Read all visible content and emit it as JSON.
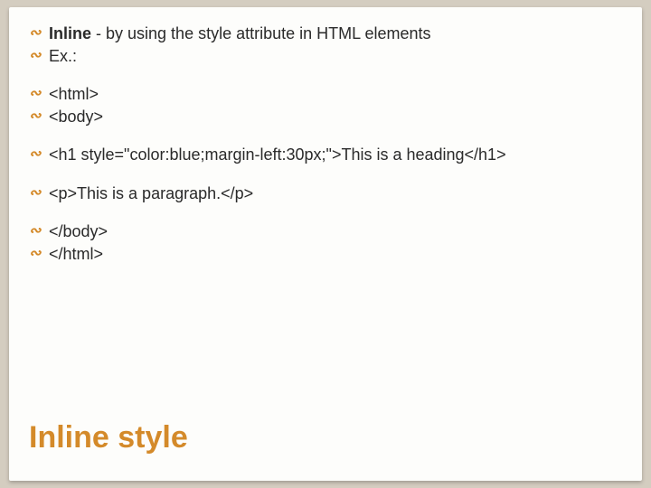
{
  "bullets": {
    "line1_bold": "Inline",
    "line1_rest": " - by using the style attribute in HTML elements",
    "line2": "Ex.:",
    "line3": "<html>",
    "line4": "<body>",
    "line5": "<h1 style=\"color:blue;margin-left:30px;\">This is a heading</h1>",
    "line6": "<p>This is a paragraph.</p>",
    "line7": "</body>",
    "line8": "</html>"
  },
  "title": "Inline style"
}
